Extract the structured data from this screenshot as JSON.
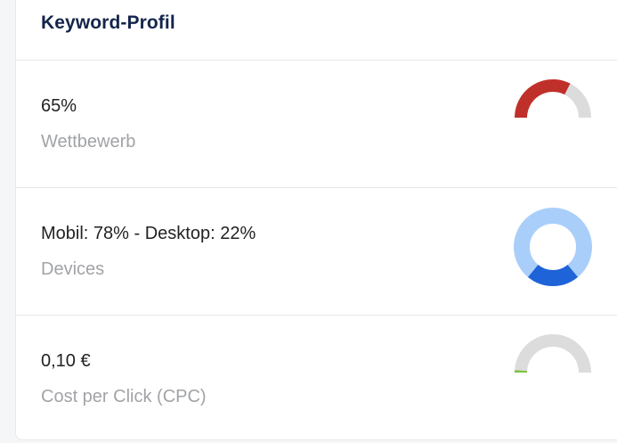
{
  "card": {
    "title": "Keyword-Profil"
  },
  "metrics": [
    {
      "value": "65%",
      "label": "Wettbewerb",
      "gauge": {
        "fraction": 0.65,
        "fill_color": "#c0302b",
        "track_color": "#dcdcdc"
      }
    },
    {
      "value": "Mobil: 78% - Desktop: 22%",
      "label": "Devices",
      "donut": {
        "mobil": 0.78,
        "desktop": 0.22,
        "mobil_color": "#a9cefa",
        "desktop_color": "#1f63d8"
      }
    },
    {
      "value": "0,10 €",
      "label": "Cost per Click (CPC)",
      "gauge": {
        "fraction": 0.02,
        "fill_color": "#7cc243",
        "track_color": "#dcdcdc"
      }
    }
  ]
}
